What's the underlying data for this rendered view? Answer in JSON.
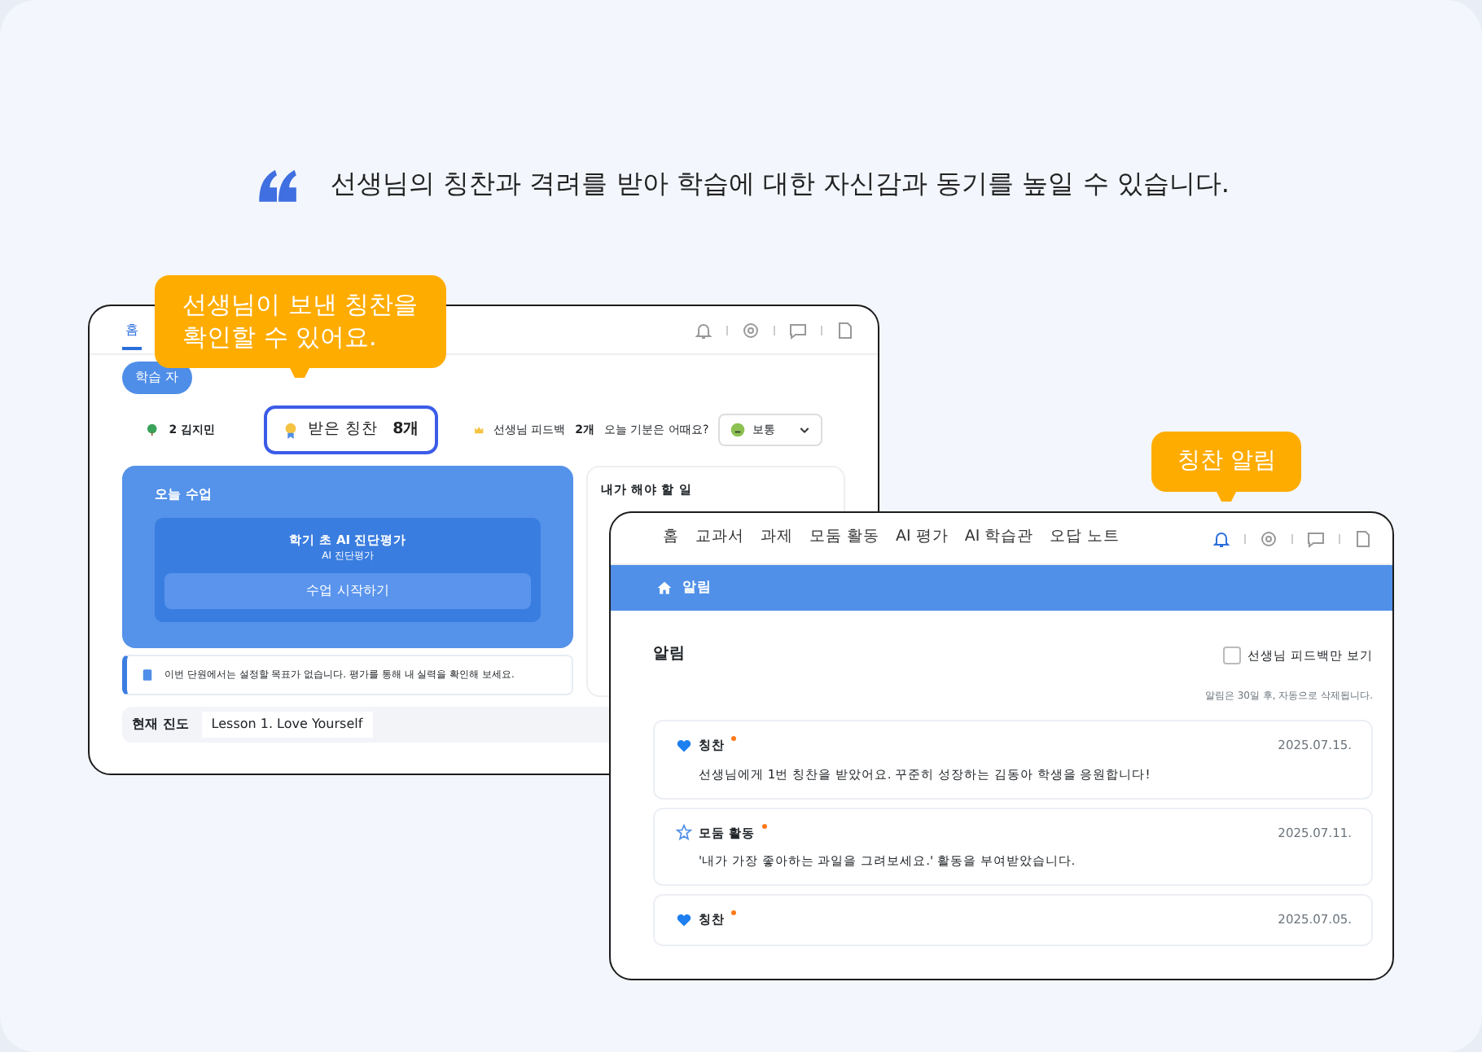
{
  "headline": {
    "text": "선생님의 칭찬과 격려를 받아 학습에 대한 자신감과 동기를 높일 수 있습니다."
  },
  "back_window": {
    "nav": [
      {
        "label": "홈",
        "selected": true
      }
    ],
    "pills": [
      {
        "label": "학습 자",
        "selected": true
      }
    ],
    "status": {
      "name": "2 김지민",
      "praise_label": "받은 칭찬",
      "praise_count": "8개",
      "highlighted": true,
      "feedback_label": "선생님 피드백",
      "feedback_count": "2개",
      "mood_question": "오늘 기분은 어때요?",
      "mood_value": "보통"
    },
    "today": {
      "title": "오늘 수업",
      "lesson_title": "학기 초 AI 진단평가",
      "lesson_subtitle": "AI 진단평가",
      "start_button": "수업 시작하기"
    },
    "notice": "이번 단원에서는 설정할 목표가 없습니다. 평가를 통해 내 실력을 확인해 보세요.",
    "todo_title": "내가 해야 할 일",
    "progress": {
      "label": "현재 진도",
      "value": "Lesson 1. Love Yourself"
    }
  },
  "callouts": [
    {
      "text": "선생님이 보낸 칭찬을\n확인할 수 있어요."
    },
    {
      "text": "칭찬 알림"
    }
  ],
  "front_window": {
    "nav": [
      {
        "label": "홈",
        "selected": false
      },
      {
        "label": "교과서",
        "selected": false
      },
      {
        "label": "과제",
        "selected": false
      },
      {
        "label": "모둠 활동",
        "selected": false
      },
      {
        "label": "AI 평가",
        "selected": false
      },
      {
        "label": "AI 학습관",
        "selected": false
      },
      {
        "label": "오답 노트",
        "selected": false
      }
    ],
    "bell_active": true,
    "banner": "알림",
    "heading": "알림",
    "filter": {
      "label": "선생님 피드백만 보기",
      "checked": false
    },
    "retention_note": "알림은 30일 후, 자동으로 삭제됩니다.",
    "notifications": [
      {
        "kind": "praise",
        "title": "칭찬",
        "unread": true,
        "date": "2025.07.15.",
        "message": "선생님에게 1번 칭찬을 받았어요. 꾸준히 성장하는 김동아 학생을 응원합니다!"
      },
      {
        "kind": "group",
        "title": "모둠 활동",
        "unread": true,
        "date": "2025.07.11.",
        "message": "'내가 가장 좋아하는 과일을 그려보세요.' 활동을 부여받았습니다."
      },
      {
        "kind": "praise",
        "title": "칭찬",
        "unread": true,
        "date": "2025.07.05."
      }
    ]
  }
}
